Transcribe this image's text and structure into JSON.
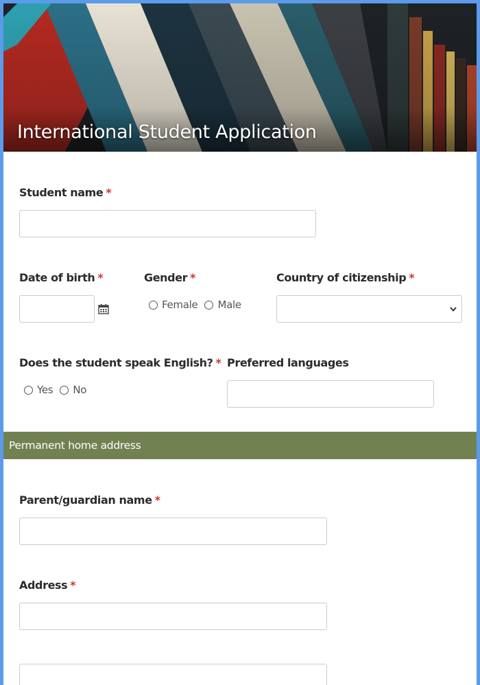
{
  "header": {
    "title": "International Student Application"
  },
  "fields": {
    "student_name": {
      "label": "Student name",
      "required": "*",
      "value": ""
    },
    "date_of_birth": {
      "label": "Date of birth",
      "required": "*",
      "value": ""
    },
    "gender": {
      "label": "Gender",
      "required": "*",
      "options": [
        "Female",
        "Male"
      ],
      "selected": null
    },
    "country": {
      "label": "Country of citizenship",
      "required": "*",
      "selected": ""
    },
    "speaks_english": {
      "label": "Does the student speak English?",
      "required": "*",
      "options": [
        "Yes",
        "No"
      ],
      "selected": null
    },
    "preferred_languages": {
      "label": "Preferred languages",
      "value": ""
    }
  },
  "section": {
    "title": "Permanent home address"
  },
  "address_fields": {
    "guardian_name": {
      "label": "Parent/guardian name",
      "required": "*",
      "value": ""
    },
    "address": {
      "label": "Address",
      "required": "*",
      "value": "",
      "line2_value": ""
    }
  },
  "colors": {
    "page_border": "#5b9bea",
    "section_bar": "#728152",
    "required_mark": "#d0342c",
    "input_border": "#c9ccd1"
  },
  "icons": {
    "date_picker": "calendar-icon",
    "select_caret": "chevron-down-icon"
  }
}
